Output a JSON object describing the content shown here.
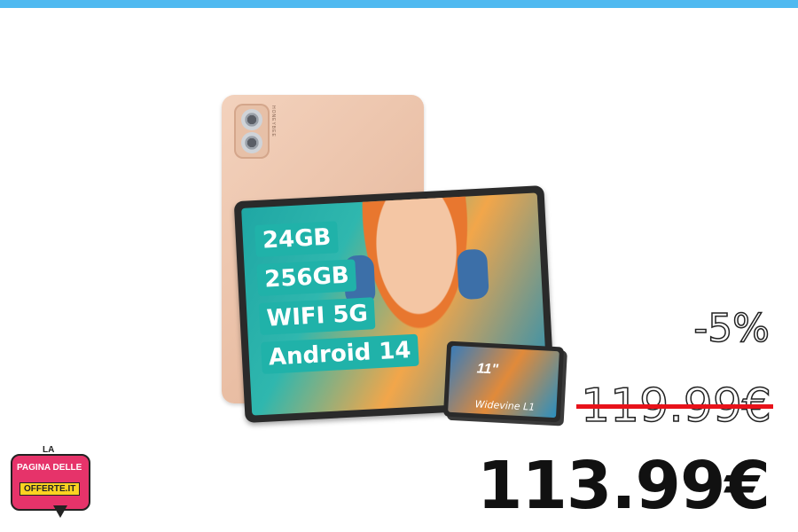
{
  "header": {
    "accent_color": "#4fb9f0"
  },
  "product": {
    "back_brand_text": "HONEYBEE",
    "spec_tags": [
      "24GB",
      "256GB",
      "WIFI 5G",
      "Android 14"
    ],
    "mini_screen_size": "11\"",
    "mini_screen_label": "Widevine L1"
  },
  "pricing": {
    "discount": "-5%",
    "old_price": "119.99€",
    "new_price": "113.99€",
    "strike_color": "#e8121a"
  },
  "logo": {
    "la": "LA",
    "line1": "PAGINA DELLE",
    "line2": "OFFERTE.IT"
  }
}
